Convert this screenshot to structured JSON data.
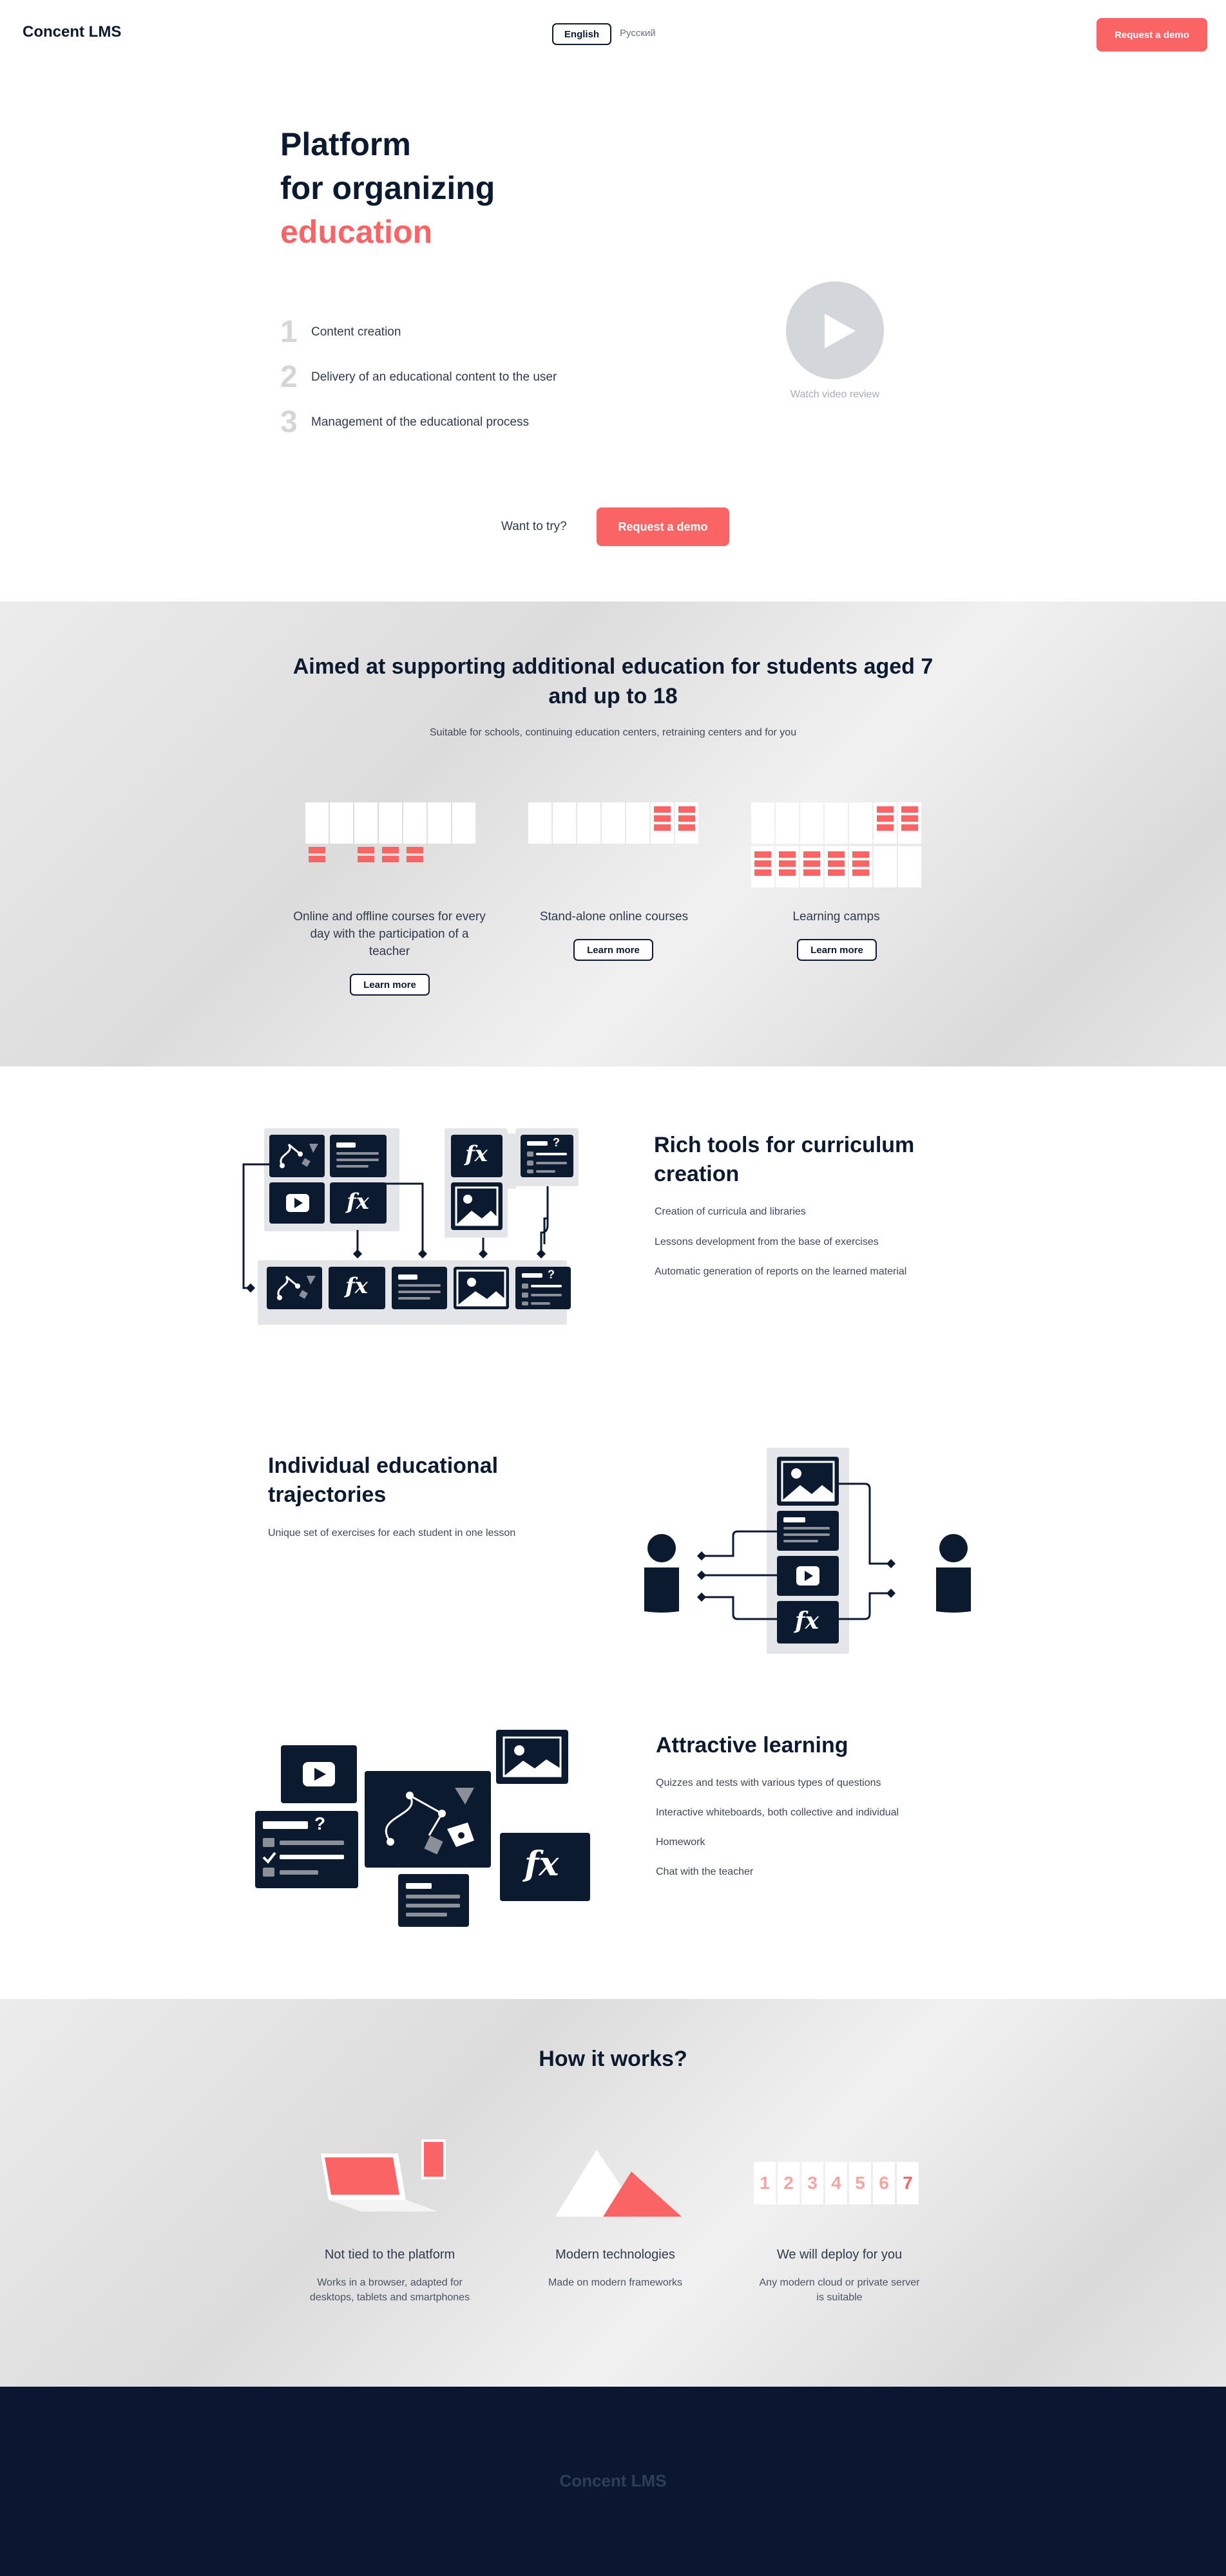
{
  "header": {
    "brand": "Concent LMS",
    "lang_active": "English",
    "lang_other": "Русский",
    "demo_label": "Request a demo"
  },
  "hero": {
    "title_line1": "Platform",
    "title_line2": "for organizing",
    "title_accent": "education",
    "steps": [
      {
        "num": "1",
        "text": "Content creation"
      },
      {
        "num": "2",
        "text": "Delivery of an educational content to the user"
      },
      {
        "num": "3",
        "text": "Management of the educational process"
      }
    ],
    "watch_label": "Watch video review",
    "want_label": "Want to try?",
    "cta_label": "Request a demo"
  },
  "audience": {
    "title": "Aimed at supporting additional education for students aged 7 and up to 18",
    "subtitle": "Suitable for schools, continuing education centers, retraining centers and for you",
    "cards": [
      {
        "label": "Online and offline courses for every day with the participation of a teacher",
        "button": "Learn more"
      },
      {
        "label": "Stand-alone online courses",
        "button": "Learn more"
      },
      {
        "label": "Learning camps",
        "button": "Learn more"
      }
    ]
  },
  "features": {
    "curriculum": {
      "title": "Rich tools for curriculum creation",
      "items": [
        "Creation of curricula and libraries",
        "Lessons development from the base of exercises",
        "Automatic generation of reports on the learned material"
      ]
    },
    "trajectories": {
      "title": "Individual educational trajectories",
      "items": [
        "Unique set of exercises for each student in one lesson"
      ]
    },
    "learning": {
      "title": "Attractive learning",
      "items": [
        "Quizzes and tests with various types of questions",
        "Interactive whiteboards, both collective and individual",
        "Homework",
        "Chat with the teacher"
      ]
    },
    "fx_label": "fx"
  },
  "how": {
    "title": "How it works?",
    "items": [
      {
        "label": "Not tied to the platform",
        "sub_line1": "Works in a browser, adapted for",
        "sub_line2": "desktops, tablets and smartphones"
      },
      {
        "label": "Modern technologies",
        "sub_line1": "Made on modern frameworks",
        "sub_line2": ""
      },
      {
        "label": "We will deploy for you",
        "sub_line1": "Any modern cloud or private server",
        "sub_line2": "is suitable"
      }
    ],
    "digits": [
      "1",
      "2",
      "3",
      "4",
      "5",
      "6",
      "7"
    ]
  },
  "footer": {
    "brand": "Concent LMS"
  },
  "colors": {
    "accent": "#fa6464",
    "navy": "#0c1a30",
    "grey_band": "#e2e2e2",
    "footer": "#0b1730"
  },
  "icons": [
    "play-icon",
    "video-icon",
    "image-icon",
    "formula-icon",
    "quiz-icon",
    "whiteboard-icon",
    "text-icon",
    "student-icon"
  ]
}
